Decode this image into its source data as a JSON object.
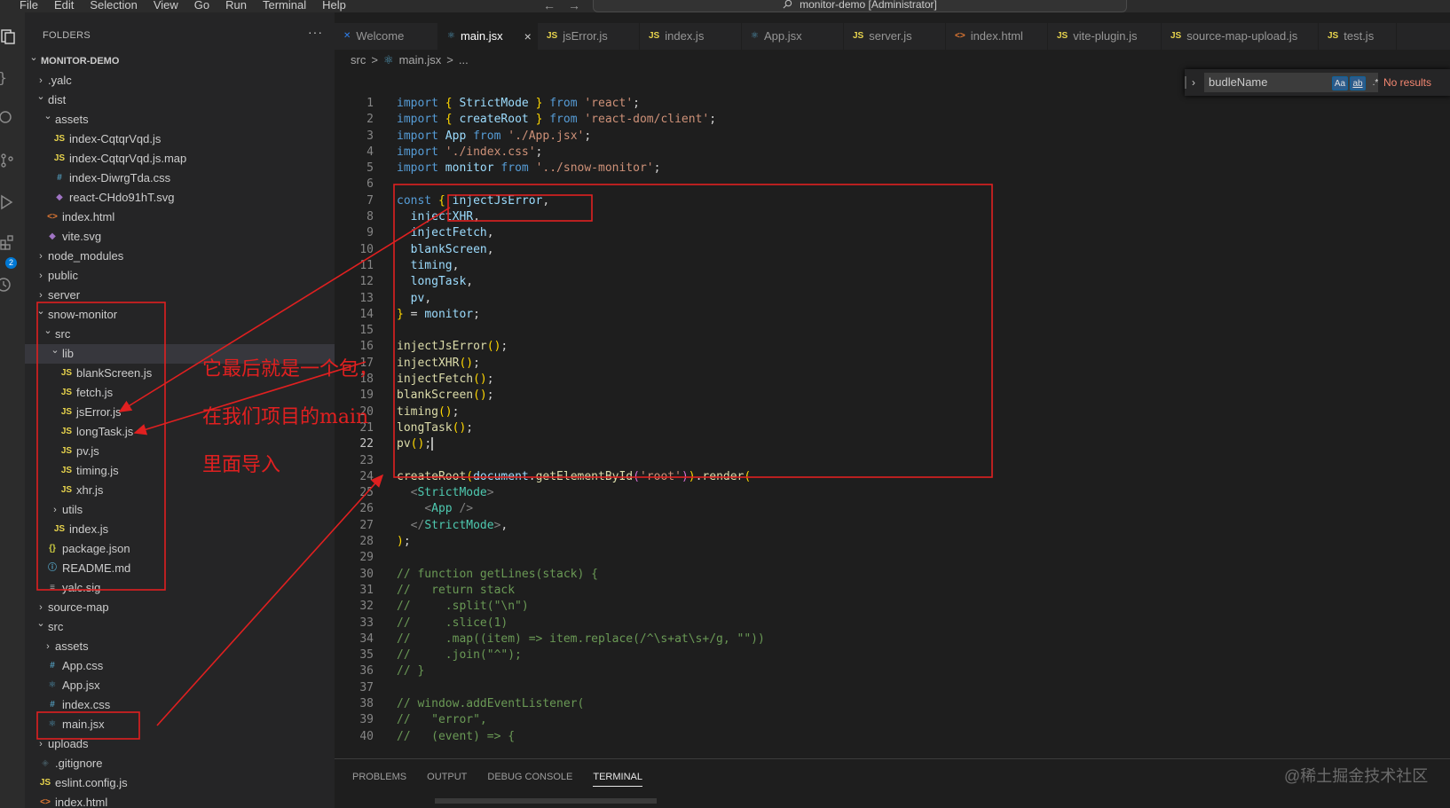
{
  "menu": [
    "File",
    "Edit",
    "Selection",
    "View",
    "Go",
    "Run",
    "Terminal",
    "Help"
  ],
  "nav": {
    "back_icon": "arrow-left-icon",
    "forward_icon": "arrow-right-icon"
  },
  "command_center": {
    "title": "monitor-demo [Administrator]",
    "icon": "search-icon"
  },
  "activity_bar": {
    "badge": "2"
  },
  "sidebar": {
    "header": "FOLDERS",
    "more": "···",
    "tree": [
      {
        "label": "MONITOR-DEMO",
        "depth": 0,
        "twisty": "open",
        "icon": "",
        "root": true
      },
      {
        "label": ".yalc",
        "depth": 1,
        "twisty": "closed",
        "icon": ""
      },
      {
        "label": "dist",
        "depth": 1,
        "twisty": "open",
        "icon": ""
      },
      {
        "label": "assets",
        "depth": 2,
        "twisty": "open",
        "icon": ""
      },
      {
        "label": "index-CqtqrVqd.js",
        "depth": 3,
        "twisty": "",
        "icon": "js"
      },
      {
        "label": "index-CqtqrVqd.js.map",
        "depth": 3,
        "twisty": "",
        "icon": "js"
      },
      {
        "label": "index-DiwrgTda.css",
        "depth": 3,
        "twisty": "",
        "icon": "css"
      },
      {
        "label": "react-CHdo91hT.svg",
        "depth": 3,
        "twisty": "",
        "icon": "svg"
      },
      {
        "label": "index.html",
        "depth": 2,
        "twisty": "",
        "icon": "html"
      },
      {
        "label": "vite.svg",
        "depth": 2,
        "twisty": "",
        "icon": "svg"
      },
      {
        "label": "node_modules",
        "depth": 1,
        "twisty": "closed",
        "icon": ""
      },
      {
        "label": "public",
        "depth": 1,
        "twisty": "closed",
        "icon": ""
      },
      {
        "label": "server",
        "depth": 1,
        "twisty": "closed",
        "icon": ""
      },
      {
        "label": "snow-monitor",
        "depth": 1,
        "twisty": "open",
        "icon": ""
      },
      {
        "label": "src",
        "depth": 2,
        "twisty": "open",
        "icon": ""
      },
      {
        "label": "lib",
        "depth": 3,
        "twisty": "open",
        "icon": "",
        "selected": true
      },
      {
        "label": "blankScreen.js",
        "depth": 4,
        "twisty": "",
        "icon": "js"
      },
      {
        "label": "fetch.js",
        "depth": 4,
        "twisty": "",
        "icon": "js"
      },
      {
        "label": "jsError.js",
        "depth": 4,
        "twisty": "",
        "icon": "js"
      },
      {
        "label": "longTask.js",
        "depth": 4,
        "twisty": "",
        "icon": "js"
      },
      {
        "label": "pv.js",
        "depth": 4,
        "twisty": "",
        "icon": "js"
      },
      {
        "label": "timing.js",
        "depth": 4,
        "twisty": "",
        "icon": "js"
      },
      {
        "label": "xhr.js",
        "depth": 4,
        "twisty": "",
        "icon": "js"
      },
      {
        "label": "utils",
        "depth": 3,
        "twisty": "closed",
        "icon": ""
      },
      {
        "label": "index.js",
        "depth": 3,
        "twisty": "",
        "icon": "js"
      },
      {
        "label": "package.json",
        "depth": 2,
        "twisty": "",
        "icon": "json"
      },
      {
        "label": "README.md",
        "depth": 2,
        "twisty": "",
        "icon": "info"
      },
      {
        "label": "yalc.sig",
        "depth": 2,
        "twisty": "",
        "icon": "text"
      },
      {
        "label": "source-map",
        "depth": 1,
        "twisty": "closed",
        "icon": ""
      },
      {
        "label": "src",
        "depth": 1,
        "twisty": "open",
        "icon": ""
      },
      {
        "label": "assets",
        "depth": 2,
        "twisty": "closed",
        "icon": ""
      },
      {
        "label": "App.css",
        "depth": 2,
        "twisty": "",
        "icon": "css"
      },
      {
        "label": "App.jsx",
        "depth": 2,
        "twisty": "",
        "icon": "react"
      },
      {
        "label": "index.css",
        "depth": 2,
        "twisty": "",
        "icon": "css"
      },
      {
        "label": "main.jsx",
        "depth": 2,
        "twisty": "",
        "icon": "react"
      },
      {
        "label": "uploads",
        "depth": 1,
        "twisty": "closed",
        "icon": ""
      },
      {
        "label": ".gitignore",
        "depth": 1,
        "twisty": "",
        "icon": "git"
      },
      {
        "label": "eslint.config.js",
        "depth": 1,
        "twisty": "",
        "icon": "js"
      },
      {
        "label": "index.html",
        "depth": 1,
        "twisty": "",
        "icon": "html"
      }
    ]
  },
  "tabs": [
    {
      "label": "Welcome",
      "icon": "vscode",
      "active": false
    },
    {
      "label": "main.jsx",
      "icon": "react",
      "active": true,
      "close": "×"
    },
    {
      "label": "jsError.js",
      "icon": "js",
      "active": false
    },
    {
      "label": "index.js",
      "icon": "js",
      "active": false
    },
    {
      "label": "App.jsx",
      "icon": "react",
      "active": false
    },
    {
      "label": "server.js",
      "icon": "js",
      "active": false
    },
    {
      "label": "index.html",
      "icon": "html",
      "active": false
    },
    {
      "label": "vite-plugin.js",
      "icon": "js",
      "active": false
    },
    {
      "label": "source-map-upload.js",
      "icon": "js",
      "active": false
    },
    {
      "label": "test.js",
      "icon": "js",
      "active": false
    }
  ],
  "breadcrumb": {
    "folder": "src",
    "sep": ">",
    "file": "main.jsx",
    "more": "..."
  },
  "find": {
    "value": "budleName",
    "match_case": "Aa",
    "whole_word": "ab",
    "regex": ".*",
    "result": "No results"
  },
  "code": [
    {
      "n": "1",
      "t": [
        [
          "kw",
          "import"
        ],
        [
          "p",
          " "
        ],
        [
          "br1",
          "{"
        ],
        [
          "p",
          " "
        ],
        [
          "id",
          "StrictMode"
        ],
        [
          "p",
          " "
        ],
        [
          "br1",
          "}"
        ],
        [
          "p",
          " "
        ],
        [
          "kw",
          "from"
        ],
        [
          "p",
          " "
        ],
        [
          "str",
          "'react'"
        ],
        [
          "p",
          ";"
        ]
      ]
    },
    {
      "n": "2",
      "t": [
        [
          "kw",
          "import"
        ],
        [
          "p",
          " "
        ],
        [
          "br1",
          "{"
        ],
        [
          "p",
          " "
        ],
        [
          "id",
          "createRoot"
        ],
        [
          "p",
          " "
        ],
        [
          "br1",
          "}"
        ],
        [
          "p",
          " "
        ],
        [
          "kw",
          "from"
        ],
        [
          "p",
          " "
        ],
        [
          "str",
          "'react-dom/client'"
        ],
        [
          "p",
          ";"
        ]
      ]
    },
    {
      "n": "3",
      "t": [
        [
          "kw",
          "import"
        ],
        [
          "p",
          " "
        ],
        [
          "id",
          "App"
        ],
        [
          "p",
          " "
        ],
        [
          "kw",
          "from"
        ],
        [
          "p",
          " "
        ],
        [
          "str",
          "'./App.jsx'"
        ],
        [
          "p",
          ";"
        ]
      ]
    },
    {
      "n": "4",
      "t": [
        [
          "kw",
          "import"
        ],
        [
          "p",
          " "
        ],
        [
          "str",
          "'./index.css'"
        ],
        [
          "p",
          ";"
        ]
      ]
    },
    {
      "n": "5",
      "t": [
        [
          "kw",
          "import"
        ],
        [
          "p",
          " "
        ],
        [
          "id",
          "monitor"
        ],
        [
          "p",
          " "
        ],
        [
          "kw",
          "from"
        ],
        [
          "p",
          " "
        ],
        [
          "str",
          "'../snow-monitor'"
        ],
        [
          "p",
          ";"
        ]
      ]
    },
    {
      "n": "6",
      "t": []
    },
    {
      "n": "7",
      "t": [
        [
          "kw",
          "const"
        ],
        [
          "p",
          " "
        ],
        [
          "br1",
          "{"
        ],
        [
          "p",
          " "
        ],
        [
          "id",
          "injectJsError"
        ],
        [
          "p",
          ","
        ]
      ]
    },
    {
      "n": "8",
      "t": [
        [
          "p",
          "  "
        ],
        [
          "id",
          "injectXHR"
        ],
        [
          "p",
          ","
        ]
      ]
    },
    {
      "n": "9",
      "t": [
        [
          "p",
          "  "
        ],
        [
          "id",
          "injectFetch"
        ],
        [
          "p",
          ","
        ]
      ]
    },
    {
      "n": "10",
      "t": [
        [
          "p",
          "  "
        ],
        [
          "id",
          "blankScreen"
        ],
        [
          "p",
          ","
        ]
      ]
    },
    {
      "n": "11",
      "t": [
        [
          "p",
          "  "
        ],
        [
          "id",
          "timing"
        ],
        [
          "p",
          ","
        ]
      ]
    },
    {
      "n": "12",
      "t": [
        [
          "p",
          "  "
        ],
        [
          "id",
          "longTask"
        ],
        [
          "p",
          ","
        ]
      ]
    },
    {
      "n": "13",
      "t": [
        [
          "p",
          "  "
        ],
        [
          "id",
          "pv"
        ],
        [
          "p",
          ","
        ]
      ]
    },
    {
      "n": "14",
      "t": [
        [
          "br1",
          "}"
        ],
        [
          "p",
          " = "
        ],
        [
          "id",
          "monitor"
        ],
        [
          "p",
          ";"
        ]
      ]
    },
    {
      "n": "15",
      "t": []
    },
    {
      "n": "16",
      "t": [
        [
          "fn",
          "injectJsError"
        ],
        [
          "br1",
          "()"
        ],
        [
          "p",
          ";"
        ]
      ]
    },
    {
      "n": "17",
      "t": [
        [
          "fn",
          "injectXHR"
        ],
        [
          "br1",
          "()"
        ],
        [
          "p",
          ";"
        ]
      ]
    },
    {
      "n": "18",
      "t": [
        [
          "fn",
          "injectFetch"
        ],
        [
          "br1",
          "()"
        ],
        [
          "p",
          ";"
        ]
      ]
    },
    {
      "n": "19",
      "t": [
        [
          "fn",
          "blankScreen"
        ],
        [
          "br1",
          "()"
        ],
        [
          "p",
          ";"
        ]
      ]
    },
    {
      "n": "20",
      "t": [
        [
          "fn",
          "timing"
        ],
        [
          "br1",
          "()"
        ],
        [
          "p",
          ";"
        ]
      ]
    },
    {
      "n": "21",
      "t": [
        [
          "fn",
          "longTask"
        ],
        [
          "br1",
          "()"
        ],
        [
          "p",
          ";"
        ]
      ]
    },
    {
      "n": "22",
      "t": [
        [
          "fn",
          "pv"
        ],
        [
          "br1",
          "()"
        ],
        [
          "p",
          ";"
        ],
        [
          "cursor",
          ""
        ]
      ],
      "current": true
    },
    {
      "n": "23",
      "t": []
    },
    {
      "n": "24",
      "t": [
        [
          "fn",
          "createRoot"
        ],
        [
          "br1",
          "("
        ],
        [
          "id",
          "document"
        ],
        [
          "p",
          "."
        ],
        [
          "fn",
          "getElementById"
        ],
        [
          "br2",
          "("
        ],
        [
          "str",
          "'root'"
        ],
        [
          "br2",
          ")"
        ],
        [
          "br1",
          ")"
        ],
        [
          "p",
          "."
        ],
        [
          "fn",
          "render"
        ],
        [
          "br1",
          "("
        ]
      ]
    },
    {
      "n": "25",
      "t": [
        [
          "p",
          "  "
        ],
        [
          "punc",
          "<"
        ],
        [
          "tag",
          "StrictMode"
        ],
        [
          "punc",
          ">"
        ]
      ]
    },
    {
      "n": "26",
      "t": [
        [
          "p",
          "    "
        ],
        [
          "punc",
          "<"
        ],
        [
          "tag",
          "App"
        ],
        [
          "p",
          " "
        ],
        [
          "punc",
          "/>"
        ]
      ]
    },
    {
      "n": "27",
      "t": [
        [
          "p",
          "  "
        ],
        [
          "punc",
          "</"
        ],
        [
          "tag",
          "StrictMode"
        ],
        [
          "punc",
          ">"
        ],
        [
          "p",
          ","
        ]
      ]
    },
    {
      "n": "28",
      "t": [
        [
          "br1",
          ")"
        ],
        [
          "p",
          ";"
        ]
      ]
    },
    {
      "n": "29",
      "t": []
    },
    {
      "n": "30",
      "t": [
        [
          "cm",
          "// function getLines(stack) {"
        ]
      ]
    },
    {
      "n": "31",
      "t": [
        [
          "cm",
          "//   return stack"
        ]
      ]
    },
    {
      "n": "32",
      "t": [
        [
          "cm",
          "//     .split(\"\\n\")"
        ]
      ]
    },
    {
      "n": "33",
      "t": [
        [
          "cm",
          "//     .slice(1)"
        ]
      ]
    },
    {
      "n": "34",
      "t": [
        [
          "cm",
          "//     .map((item) => item.replace(/^\\s+at\\s+/g, \"\"))"
        ]
      ]
    },
    {
      "n": "35",
      "t": [
        [
          "cm",
          "//     .join(\"^\");"
        ]
      ]
    },
    {
      "n": "36",
      "t": [
        [
          "cm",
          "// }"
        ]
      ]
    },
    {
      "n": "37",
      "t": []
    },
    {
      "n": "38",
      "t": [
        [
          "cm",
          "// window.addEventListener("
        ]
      ]
    },
    {
      "n": "39",
      "t": [
        [
          "cm",
          "//   \"error\","
        ]
      ]
    },
    {
      "n": "40",
      "t": [
        [
          "cm",
          "//   (event) => {"
        ]
      ]
    }
  ],
  "panel_tabs": [
    {
      "label": "PROBLEMS",
      "active": false
    },
    {
      "label": "OUTPUT",
      "active": false
    },
    {
      "label": "DEBUG CONSOLE",
      "active": false
    },
    {
      "label": "TERMINAL",
      "active": true
    }
  ],
  "annotations": {
    "line1": "它最后就是一个包，",
    "line2": "在我们项目的main",
    "line3": "里面导入",
    "color": "#e02020"
  },
  "watermark": "@稀土掘金技术社区",
  "colors": {
    "accent": "#0078d4",
    "annotation": "#e02020"
  }
}
